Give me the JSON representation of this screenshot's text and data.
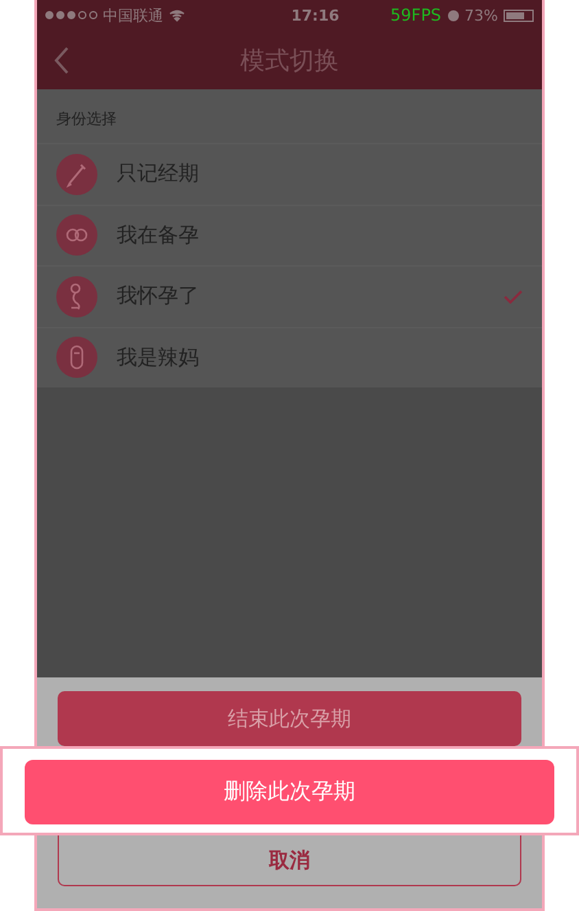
{
  "status_bar": {
    "carrier": "中国联通",
    "time": "17:16",
    "fps": "59FPS",
    "battery": "73%"
  },
  "nav": {
    "title": "模式切换"
  },
  "section": {
    "label": "身份选择"
  },
  "options": [
    {
      "label": "只记经期",
      "kind": "pen",
      "selected": false
    },
    {
      "label": "我在备孕",
      "kind": "rings",
      "selected": false
    },
    {
      "label": "我怀孕了",
      "kind": "figure",
      "selected": true
    },
    {
      "label": "我是辣妈",
      "kind": "bottle",
      "selected": false
    }
  ],
  "sheet": {
    "buttons": [
      {
        "label": "结束此次孕期",
        "kind": "filled"
      },
      {
        "label": "删除此次孕期",
        "kind": "callout"
      },
      {
        "label": "取消",
        "kind": "outline"
      }
    ]
  }
}
